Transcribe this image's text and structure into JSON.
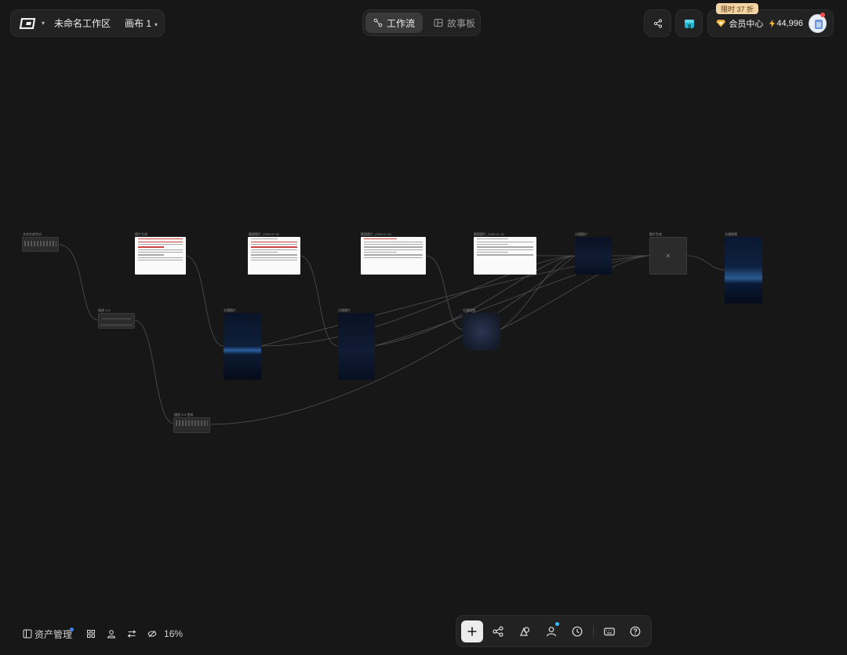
{
  "header": {
    "workspace_name": "未命名工作区",
    "canvas_name": "画布 1",
    "logo_icon": "app-logo",
    "canvas_chevron": "chevron-down-icon"
  },
  "tabs": [
    {
      "label": "工作流",
      "icon": "workflow-icon",
      "active": true
    },
    {
      "label": "故事板",
      "icon": "storyboard-icon",
      "active": false
    }
  ],
  "topright": {
    "share_icon": "share-icon",
    "store_icon": "store-icon",
    "promo_badge": "限时 37 折",
    "member_label": "会员中心",
    "credits": "44,996"
  },
  "nodes": [
    {
      "title": "文本生成节点"
    },
    {
      "title": "图片生成"
    },
    {
      "title": "截图图片_2026-07-15"
    },
    {
      "title": "截图图片_2026-07-15"
    },
    {
      "title": "截图图片_2026-07-15"
    },
    {
      "title": "分镜图片"
    },
    {
      "title": "图片生成"
    },
    {
      "title": "分镜视频"
    },
    {
      "title": "描述 V-3"
    },
    {
      "title": "分镜图片"
    },
    {
      "title": "分镜图片"
    },
    {
      "title": "分镜视频"
    },
    {
      "title": "描述 V-3 合成"
    }
  ],
  "bottomleft": {
    "assets_label": "资产管理",
    "zoom": "16%"
  },
  "toolbar": {
    "items": [
      "add-icon",
      "workflow-share-icon",
      "shapes-icon",
      "user-icon",
      "history-icon",
      "keyboard-icon",
      "help-icon"
    ]
  },
  "colors": {
    "background": "#171717",
    "panel": "#222222",
    "accent_promo": "#f3d4a4",
    "store": "#22b8cf"
  }
}
